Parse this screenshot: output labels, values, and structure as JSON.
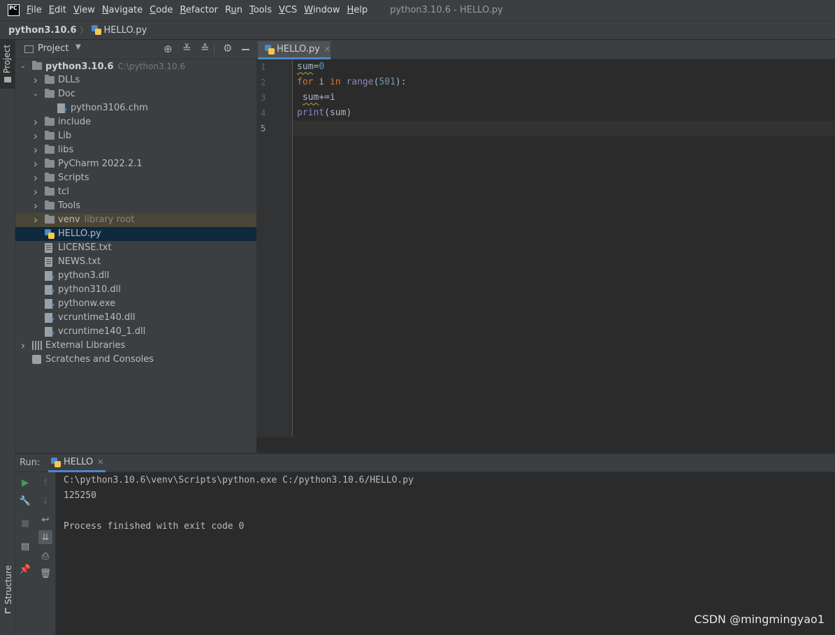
{
  "menubar": {
    "logo": "PC",
    "items": [
      {
        "label": "File",
        "mnemonic": "F",
        "rest": "ile"
      },
      {
        "label": "Edit",
        "mnemonic": "E",
        "rest": "dit"
      },
      {
        "label": "View",
        "mnemonic": "V",
        "rest": "iew"
      },
      {
        "label": "Navigate",
        "mnemonic": "N",
        "rest": "avigate"
      },
      {
        "label": "Code",
        "mnemonic": "C",
        "rest": "ode"
      },
      {
        "label": "Refactor",
        "mnemonic": "R",
        "rest": "efactor"
      },
      {
        "label": "Run",
        "pre": "R",
        "mnemonic": "u",
        "rest": "n"
      },
      {
        "label": "Tools",
        "mnemonic": "T",
        "rest": "ools"
      },
      {
        "label": "VCS",
        "mnemonic": "V",
        "rest": "CS"
      },
      {
        "label": "Window",
        "mnemonic": "W",
        "rest": "indow"
      },
      {
        "label": "Help",
        "mnemonic": "H",
        "rest": "elp"
      }
    ],
    "window_title": "python3.10.6 - HELLO.py"
  },
  "breadcrumb": {
    "project": "python3.10.6",
    "file": "HELLO.py"
  },
  "left_strip": {
    "project_tab": "Project",
    "structure_tab": "Structure"
  },
  "project_panel": {
    "title": "Project",
    "tree": [
      {
        "label": "python3.10.6",
        "hint": "C:\\python3.10.6",
        "type": "folder",
        "depth": 0,
        "expanded": true,
        "bold": true
      },
      {
        "label": "DLLs",
        "type": "folder",
        "depth": 1,
        "expanded": false
      },
      {
        "label": "Doc",
        "type": "folder",
        "depth": 1,
        "expanded": true
      },
      {
        "label": "python3106.chm",
        "type": "unknown",
        "depth": 2
      },
      {
        "label": "include",
        "type": "folder",
        "depth": 1,
        "expanded": false
      },
      {
        "label": "Lib",
        "type": "folder",
        "depth": 1,
        "expanded": false
      },
      {
        "label": "libs",
        "type": "folder",
        "depth": 1,
        "expanded": false
      },
      {
        "label": "PyCharm 2022.2.1",
        "type": "folder",
        "depth": 1,
        "expanded": false
      },
      {
        "label": "Scripts",
        "type": "folder",
        "depth": 1,
        "expanded": false
      },
      {
        "label": "tcl",
        "type": "folder",
        "depth": 1,
        "expanded": false
      },
      {
        "label": "Tools",
        "type": "folder",
        "depth": 1,
        "expanded": false
      },
      {
        "label": "venv",
        "hint": "library root",
        "type": "folder",
        "depth": 1,
        "expanded": false,
        "venv": true
      },
      {
        "label": "HELLO.py",
        "type": "python",
        "depth": 1,
        "selected": true
      },
      {
        "label": "LICENSE.txt",
        "type": "text",
        "depth": 1
      },
      {
        "label": "NEWS.txt",
        "type": "text",
        "depth": 1
      },
      {
        "label": "python3.dll",
        "type": "unknown",
        "depth": 1
      },
      {
        "label": "python310.dll",
        "type": "unknown",
        "depth": 1
      },
      {
        "label": "pythonw.exe",
        "type": "unknown",
        "depth": 1
      },
      {
        "label": "vcruntime140.dll",
        "type": "unknown",
        "depth": 1
      },
      {
        "label": "vcruntime140_1.dll",
        "type": "unknown",
        "depth": 1
      },
      {
        "label": "External Libraries",
        "type": "libraries",
        "depth": 0,
        "expanded": false
      },
      {
        "label": "Scratches and Consoles",
        "type": "scratches",
        "depth": 0
      }
    ]
  },
  "editor": {
    "tab_label": "HELLO.py",
    "line_numbers": [
      "1",
      "2",
      "3",
      "4",
      "5"
    ],
    "current_line": 5,
    "code_lines": [
      "sum=0",
      "for i in range(501):",
      " sum+=i",
      "print(sum)",
      ""
    ]
  },
  "run_panel": {
    "label": "Run:",
    "tab_label": "HELLO",
    "console_lines": [
      "C:\\python3.10.6\\venv\\Scripts\\python.exe C:/python3.10.6/HELLO.py",
      "125250",
      "",
      "Process finished with exit code 0"
    ]
  },
  "watermark": "CSDN @mingmingyao1",
  "colors": {
    "background": "#2b2b2b",
    "panel": "#3c3f41",
    "selection": "#0d293e",
    "keyword": "#cc7832",
    "number": "#6897bb",
    "builtin": "#8888c6",
    "accent": "#4a88c7",
    "run_green": "#499c54"
  }
}
